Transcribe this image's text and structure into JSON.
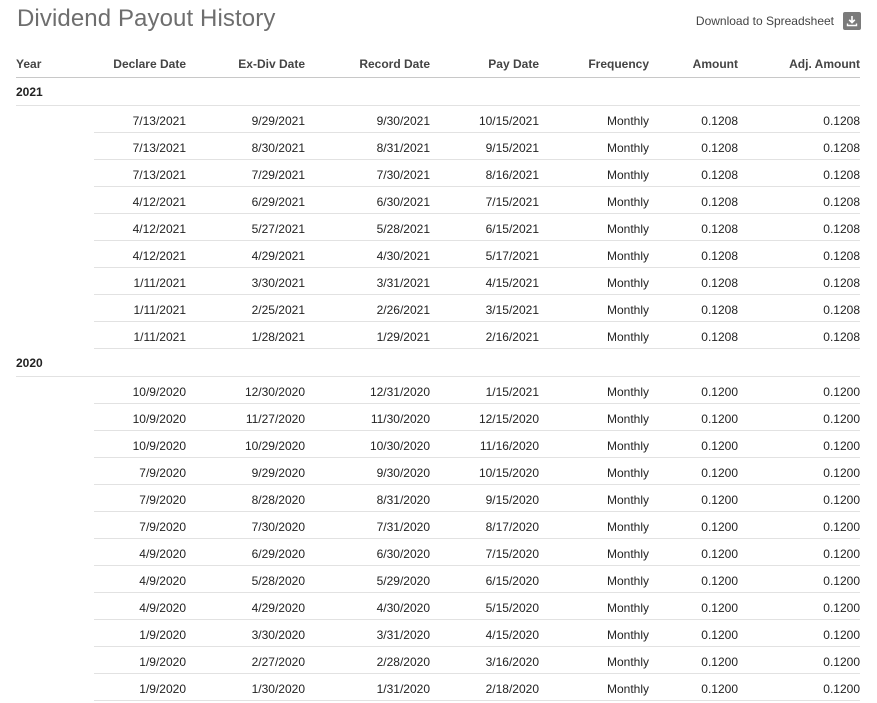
{
  "header": {
    "title": "Dividend Payout History",
    "download_label": "Download to Spreadsheet"
  },
  "table": {
    "columns": [
      "Year",
      "Declare Date",
      "Ex-Div Date",
      "Record Date",
      "Pay Date",
      "Frequency",
      "Amount",
      "Adj. Amount"
    ],
    "groups": [
      {
        "year": "2021",
        "rows": [
          [
            "7/13/2021",
            "9/29/2021",
            "9/30/2021",
            "10/15/2021",
            "Monthly",
            "0.1208",
            "0.1208"
          ],
          [
            "7/13/2021",
            "8/30/2021",
            "8/31/2021",
            "9/15/2021",
            "Monthly",
            "0.1208",
            "0.1208"
          ],
          [
            "7/13/2021",
            "7/29/2021",
            "7/30/2021",
            "8/16/2021",
            "Monthly",
            "0.1208",
            "0.1208"
          ],
          [
            "4/12/2021",
            "6/29/2021",
            "6/30/2021",
            "7/15/2021",
            "Monthly",
            "0.1208",
            "0.1208"
          ],
          [
            "4/12/2021",
            "5/27/2021",
            "5/28/2021",
            "6/15/2021",
            "Monthly",
            "0.1208",
            "0.1208"
          ],
          [
            "4/12/2021",
            "4/29/2021",
            "4/30/2021",
            "5/17/2021",
            "Monthly",
            "0.1208",
            "0.1208"
          ],
          [
            "1/11/2021",
            "3/30/2021",
            "3/31/2021",
            "4/15/2021",
            "Monthly",
            "0.1208",
            "0.1208"
          ],
          [
            "1/11/2021",
            "2/25/2021",
            "2/26/2021",
            "3/15/2021",
            "Monthly",
            "0.1208",
            "0.1208"
          ],
          [
            "1/11/2021",
            "1/28/2021",
            "1/29/2021",
            "2/16/2021",
            "Monthly",
            "0.1208",
            "0.1208"
          ]
        ]
      },
      {
        "year": "2020",
        "rows": [
          [
            "10/9/2020",
            "12/30/2020",
            "12/31/2020",
            "1/15/2021",
            "Monthly",
            "0.1200",
            "0.1200"
          ],
          [
            "10/9/2020",
            "11/27/2020",
            "11/30/2020",
            "12/15/2020",
            "Monthly",
            "0.1200",
            "0.1200"
          ],
          [
            "10/9/2020",
            "10/29/2020",
            "10/30/2020",
            "11/16/2020",
            "Monthly",
            "0.1200",
            "0.1200"
          ],
          [
            "7/9/2020",
            "9/29/2020",
            "9/30/2020",
            "10/15/2020",
            "Monthly",
            "0.1200",
            "0.1200"
          ],
          [
            "7/9/2020",
            "8/28/2020",
            "8/31/2020",
            "9/15/2020",
            "Monthly",
            "0.1200",
            "0.1200"
          ],
          [
            "7/9/2020",
            "7/30/2020",
            "7/31/2020",
            "8/17/2020",
            "Monthly",
            "0.1200",
            "0.1200"
          ],
          [
            "4/9/2020",
            "6/29/2020",
            "6/30/2020",
            "7/15/2020",
            "Monthly",
            "0.1200",
            "0.1200"
          ],
          [
            "4/9/2020",
            "5/28/2020",
            "5/29/2020",
            "6/15/2020",
            "Monthly",
            "0.1200",
            "0.1200"
          ],
          [
            "4/9/2020",
            "4/29/2020",
            "4/30/2020",
            "5/15/2020",
            "Monthly",
            "0.1200",
            "0.1200"
          ],
          [
            "1/9/2020",
            "3/30/2020",
            "3/31/2020",
            "4/15/2020",
            "Monthly",
            "0.1200",
            "0.1200"
          ],
          [
            "1/9/2020",
            "2/27/2020",
            "2/28/2020",
            "3/16/2020",
            "Monthly",
            "0.1200",
            "0.1200"
          ],
          [
            "1/9/2020",
            "1/30/2020",
            "1/31/2020",
            "2/18/2020",
            "Monthly",
            "0.1200",
            "0.1200"
          ]
        ]
      }
    ]
  },
  "icons": {
    "download": "download-icon"
  },
  "colors": {
    "title": "#6e6e6e",
    "icon_bg": "#7b7b7b",
    "divider": "#e2e2e2"
  }
}
